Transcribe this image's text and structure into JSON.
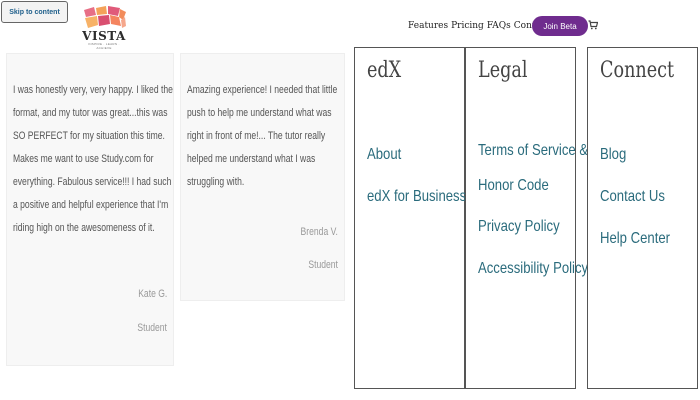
{
  "skip_link": "Skip to content",
  "logo": {
    "word": "VISTA",
    "tagline": "INSPIRE · LEARN · ACHIEVE"
  },
  "nav": {
    "links": [
      "Features",
      "Pricing",
      "FAQs",
      "Contact"
    ],
    "join_label": "Join Beta",
    "cart_icon": "cart-icon"
  },
  "testimonials": [
    {
      "quote": "I was honestly very, very happy. I liked the format, and my tutor was great...this was SO PERFECT for my situation this time. Makes me want to use Study.com for everything. Fabulous service!!! I had such a positive and helpful experience that I'm riding high on the awesomeness of it.",
      "author": "Kate G.",
      "role": "Student"
    },
    {
      "quote": "Amazing experience! I needed that little push to help me understand what was right in front of me!... The tutor really helped me understand what I was struggling with.",
      "author": "Brenda V.",
      "role": "Student"
    }
  ],
  "footer": {
    "edx": {
      "heading": "edX",
      "links": [
        "About",
        "edX for Business"
      ]
    },
    "legal": {
      "heading": "Legal",
      "links": [
        "Terms of Service &",
        "Honor Code",
        "Privacy Policy",
        "Accessibility Policy"
      ]
    },
    "connect": {
      "heading": "Connect",
      "links": [
        "Blog",
        "Contact Us",
        "Help Center"
      ]
    }
  },
  "colors": {
    "accent": "#6f2c8e",
    "link": "#2a6b7c",
    "heading": "#444444"
  }
}
